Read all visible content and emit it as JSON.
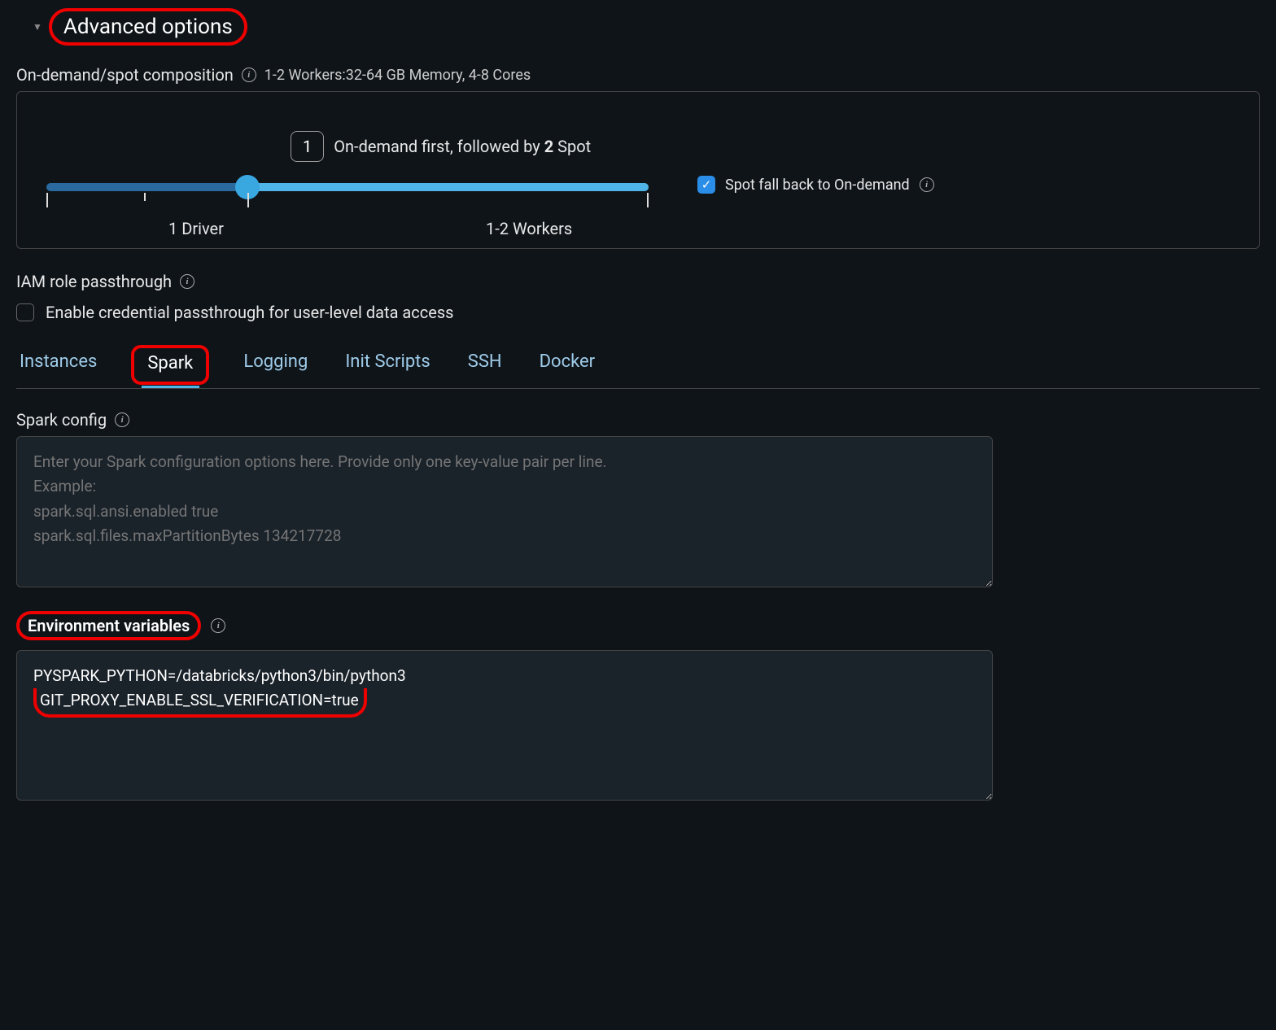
{
  "header": {
    "title": "Advanced options"
  },
  "composition": {
    "label": "On-demand/spot composition",
    "summary": "1-2 Workers:32-64 GB Memory, 4-8 Cores",
    "tooltip_value": "1",
    "tooltip_text_prefix": "On-demand first, followed by ",
    "tooltip_text_bold": "2",
    "tooltip_text_suffix": " Spot",
    "driver_label": "1 Driver",
    "workers_label": "1-2 Workers",
    "spot_fallback_label": "Spot fall back to On-demand"
  },
  "iam": {
    "label": "IAM role passthrough",
    "checkbox_label": "Enable credential passthrough for user-level data access"
  },
  "tabs": {
    "items": [
      {
        "label": "Instances"
      },
      {
        "label": "Spark"
      },
      {
        "label": "Logging"
      },
      {
        "label": "Init Scripts"
      },
      {
        "label": "SSH"
      },
      {
        "label": "Docker"
      }
    ]
  },
  "spark_config": {
    "label": "Spark config",
    "placeholder": "Enter your Spark configuration options here. Provide only one key-value pair per line.\nExample:\nspark.sql.ansi.enabled true\nspark.sql.files.maxPartitionBytes 134217728"
  },
  "env_vars": {
    "label": "Environment variables",
    "line1": "PYSPARK_PYTHON=/databricks/python3/bin/python3",
    "line2": "GIT_PROXY_ENABLE_SSL_VERIFICATION=true"
  }
}
